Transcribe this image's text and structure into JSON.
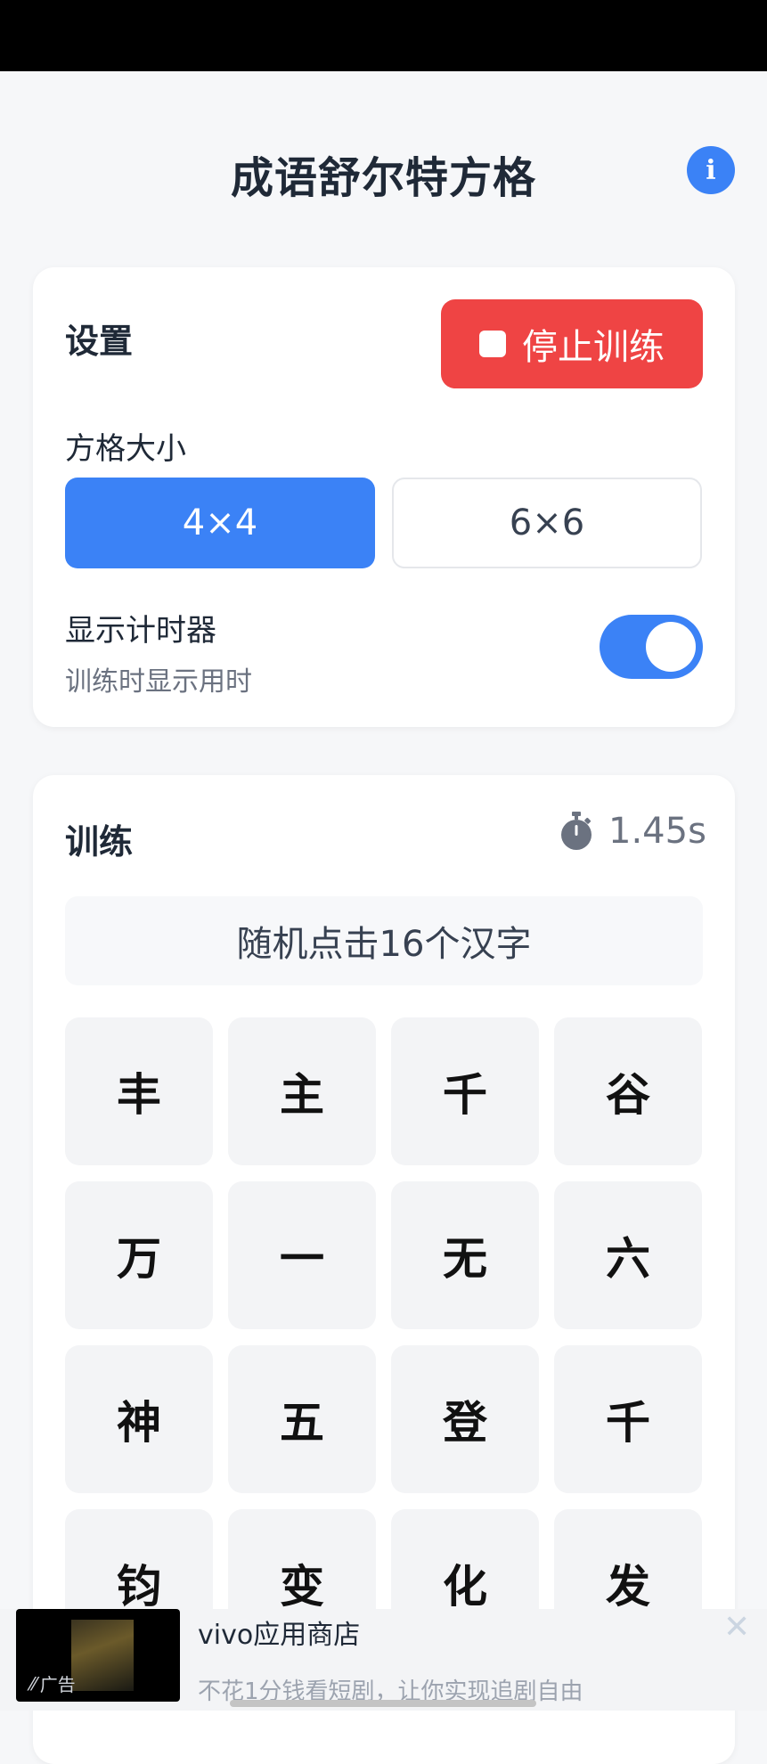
{
  "header": {
    "title": "成语舒尔特方格"
  },
  "settings": {
    "title": "设置",
    "stop_label": "停止训练",
    "grid_size_label": "方格大小",
    "size_4": "4×4",
    "size_6": "6×6",
    "timer_label": "显示计时器",
    "timer_hint": "训练时显示用时"
  },
  "training": {
    "title": "训练",
    "time": "1.45s",
    "instruction": "随机点击16个汉字",
    "cells": [
      "丰",
      "主",
      "千",
      "谷",
      "万",
      "一",
      "无",
      "六",
      "神",
      "五",
      "登",
      "千",
      "钧",
      "变",
      "化",
      "发"
    ]
  },
  "ad": {
    "badge": "广告",
    "title": "vivo应用商店",
    "desc": "不花1分钱看短剧，让你实现追剧自由"
  },
  "colors": {
    "accent": "#3b82f6",
    "danger": "#ef4444"
  }
}
